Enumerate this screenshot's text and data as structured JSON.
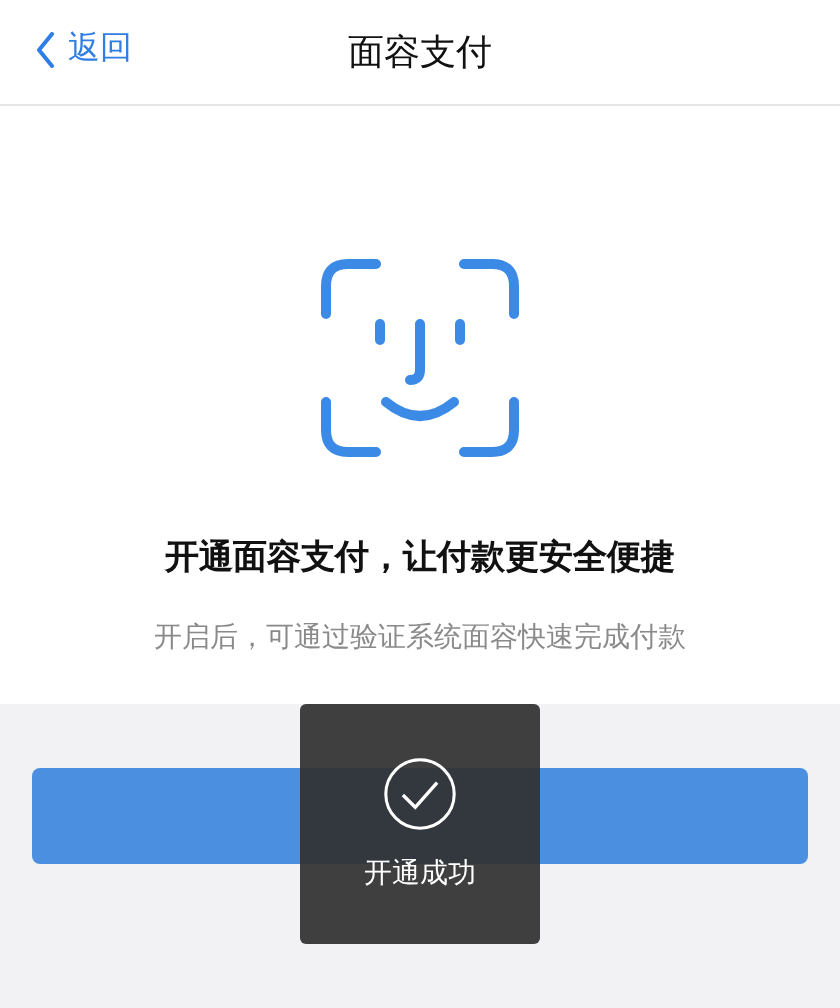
{
  "nav": {
    "back": "返回",
    "title": "面容支付"
  },
  "headline": "开通面容支付，让付款更安全便捷",
  "description": "开启后，可通过验证系统面容快速完成付款",
  "toast": {
    "text": "开通成功"
  }
}
